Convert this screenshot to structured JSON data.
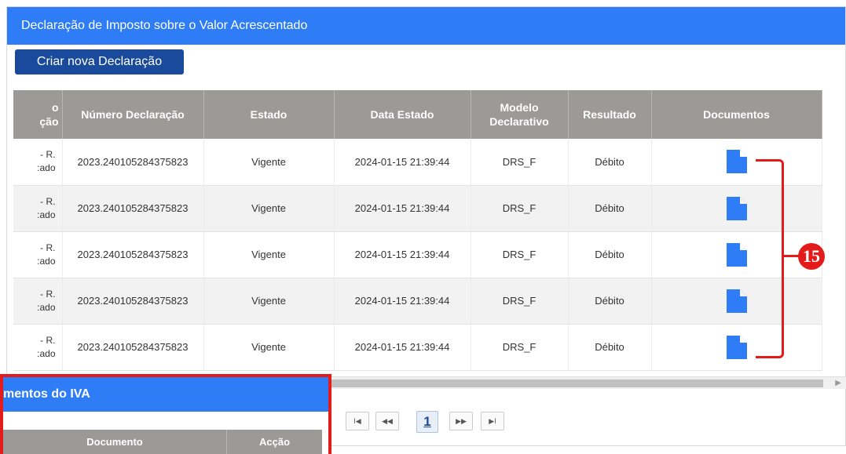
{
  "panel": {
    "title": "Declaração de Imposto sobre o Valor Acrescentado",
    "create_button": "Criar nova Declaração"
  },
  "table": {
    "headers": {
      "col0_line1": "o",
      "col0_line2": "ção",
      "numero": "Número Declaração",
      "estado": "Estado",
      "data": "Data Estado",
      "modelo": "Modelo Declarativo",
      "resultado": "Resultado",
      "documentos": "Documentos"
    },
    "rows": [
      {
        "col0_line1": "- R.",
        "col0_line2": ":ado",
        "numero": "2023.240105284375823",
        "estado": "Vigente",
        "data": "2024-01-15 21:39:44",
        "modelo": "DRS_F",
        "resultado": "Débito",
        "doc_icon": "document-icon"
      },
      {
        "col0_line1": "- R.",
        "col0_line2": ":ado",
        "numero": "2023.240105284375823",
        "estado": "Vigente",
        "data": "2024-01-15 21:39:44",
        "modelo": "DRS_F",
        "resultado": "Débito",
        "doc_icon": "document-icon"
      },
      {
        "col0_line1": "- R.",
        "col0_line2": ":ado",
        "numero": "2023.240105284375823",
        "estado": "Vigente",
        "data": "2024-01-15 21:39:44",
        "modelo": "DRS_F",
        "resultado": "Débito",
        "doc_icon": "document-icon"
      },
      {
        "col0_line1": "- R.",
        "col0_line2": ":ado",
        "numero": "2023.240105284375823",
        "estado": "Vigente",
        "data": "2024-01-15 21:39:44",
        "modelo": "DRS_F",
        "resultado": "Débito",
        "doc_icon": "document-icon"
      },
      {
        "col0_line1": "- R.",
        "col0_line2": ":ado",
        "numero": "2023.240105284375823",
        "estado": "Vigente",
        "data": "2024-01-15 21:39:44",
        "modelo": "DRS_F",
        "resultado": "Débito",
        "doc_icon": "document-icon"
      }
    ]
  },
  "pagination": {
    "first_icon": "first-page-icon",
    "first": "I◀",
    "prev_icon": "previous-page-icon",
    "prev": "◀◀",
    "current_page": "1",
    "next_icon": "next-page-icon",
    "next": "▶▶",
    "last_icon": "last-page-icon",
    "last": "▶I"
  },
  "iva_panel": {
    "title": "mentos do IVA",
    "col_documento": "Documento",
    "col_accao": "Acção"
  },
  "annotation": {
    "callout_number": "15"
  },
  "colors": {
    "header_blue": "#2e7cf6",
    "button_navy": "#1a4a9c",
    "table_header_gray": "#9c9a97",
    "annotation_red": "#e31b1b",
    "doc_icon_blue": "#2e7cf6"
  }
}
